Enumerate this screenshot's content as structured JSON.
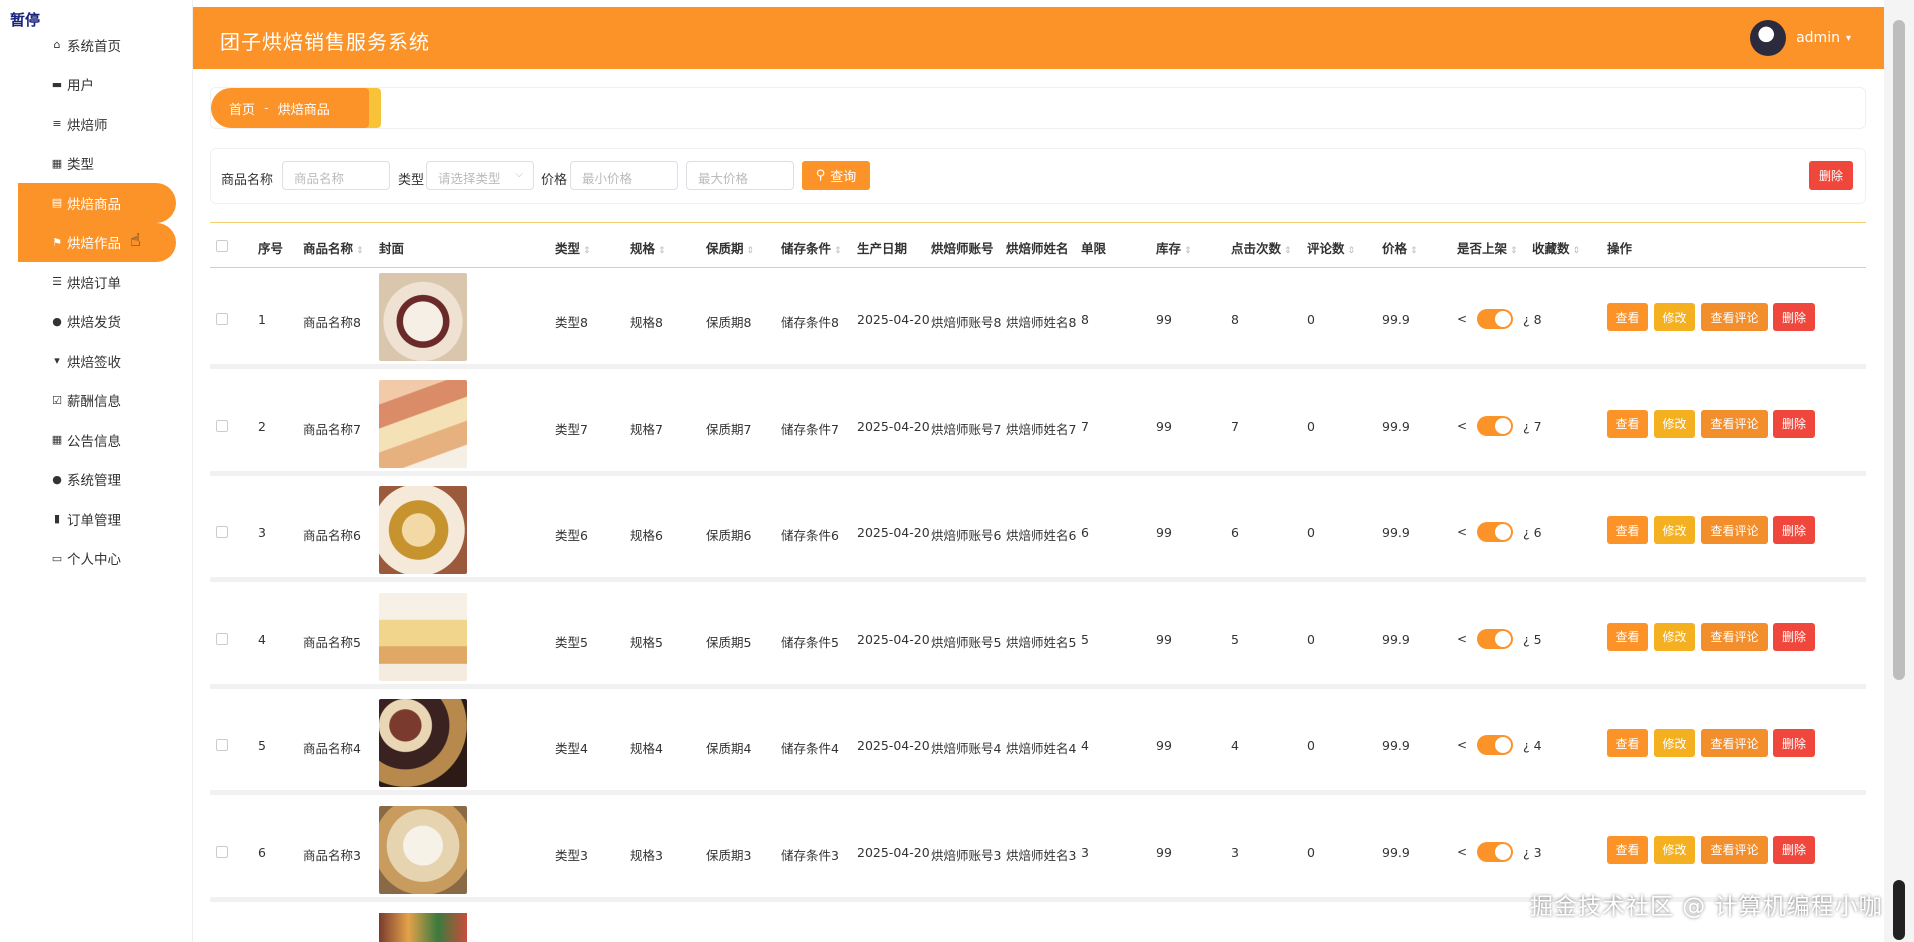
{
  "status_text": "暂停",
  "app_title": "团子烘焙销售服务系统",
  "user": {
    "name": "admin"
  },
  "sidebar": {
    "items": [
      {
        "label": "系统首页",
        "icon": "home-icon",
        "glyph": "⌂"
      },
      {
        "label": "用户",
        "icon": "monitor-icon",
        "glyph": "▬"
      },
      {
        "label": "烘焙师",
        "icon": "list-icon",
        "glyph": "≡"
      },
      {
        "label": "类型",
        "icon": "grid-icon",
        "glyph": "▦"
      },
      {
        "label": "烘焙商品",
        "icon": "clipboard-icon",
        "glyph": "▤",
        "active": true
      },
      {
        "label": "烘焙作品",
        "icon": "flag-icon",
        "glyph": "⚑",
        "active": true
      },
      {
        "label": "烘焙订单",
        "icon": "sliders-icon",
        "glyph": "☰"
      },
      {
        "label": "烘焙发货",
        "icon": "user-icon",
        "glyph": "●"
      },
      {
        "label": "烘焙签收",
        "icon": "cup-icon",
        "glyph": "▾"
      },
      {
        "label": "薪酬信息",
        "icon": "checklist-icon",
        "glyph": "☑"
      },
      {
        "label": "公告信息",
        "icon": "grid-icon",
        "glyph": "▦"
      },
      {
        "label": "系统管理",
        "icon": "user-icon",
        "glyph": "●"
      },
      {
        "label": "订单管理",
        "icon": "bar-chart-icon",
        "glyph": "▮"
      },
      {
        "label": "个人中心",
        "icon": "calendar-icon",
        "glyph": "▭"
      }
    ]
  },
  "breadcrumb": {
    "home": "首页",
    "sep": "-",
    "current": "烘焙商品"
  },
  "filter": {
    "name_label": "商品名称",
    "name_placeholder": "商品名称",
    "type_label": "类型",
    "type_placeholder": "请选择类型",
    "price_label": "价格",
    "min_placeholder": "最小价格",
    "max_placeholder": "最大价格",
    "search_label": "查询",
    "delete_label": "删除"
  },
  "table": {
    "headers": {
      "index": "序号",
      "name": "商品名称",
      "cover": "封面",
      "type": "类型",
      "spec": "规格",
      "shelf": "保质期",
      "storage": "储存条件",
      "date": "生产日期",
      "baker_acc": "烘焙师账号",
      "baker_name": "烘焙师姓名",
      "limit": "单限",
      "stock": "库存",
      "clicks": "点击次数",
      "comments": "评论数",
      "price": "价格",
      "on_sale": "是否上架",
      "favs": "收藏数",
      "ops": "操作"
    },
    "actions": {
      "view": "查看",
      "edit": "修改",
      "comments": "查看评论",
      "delete": "删除"
    },
    "rows": [
      {
        "index": "1",
        "name": "商品名称8",
        "type": "类型8",
        "spec": "规格8",
        "shelf": "保质期8",
        "storage": "储存条件8",
        "date": "2025-04-20",
        "baker_acc": "烘焙师账号8",
        "baker_name": "烘焙师姓名8",
        "limit": "8",
        "stock": "99",
        "clicks": "8",
        "comments": "0",
        "price": "99.9",
        "favs": "¿ 8",
        "cover": "cover-cake-berries"
      },
      {
        "index": "2",
        "name": "商品名称7",
        "type": "类型7",
        "spec": "规格7",
        "shelf": "保质期7",
        "storage": "储存条件7",
        "date": "2025-04-20",
        "baker_acc": "烘焙师账号7",
        "baker_name": "烘焙师姓名7",
        "limit": "7",
        "stock": "99",
        "clicks": "7",
        "comments": "0",
        "price": "99.9",
        "favs": "¿ 7",
        "cover": "cover-macarons"
      },
      {
        "index": "3",
        "name": "商品名称6",
        "type": "类型6",
        "spec": "规格6",
        "shelf": "保质期6",
        "storage": "储存条件6",
        "date": "2025-04-20",
        "baker_acc": "烘焙师账号6",
        "baker_name": "烘焙师姓名6",
        "limit": "6",
        "stock": "99",
        "clicks": "6",
        "comments": "0",
        "price": "99.9",
        "favs": "¿ 6",
        "cover": "cover-pastry"
      },
      {
        "index": "4",
        "name": "商品名称5",
        "type": "类型5",
        "spec": "规格5",
        "shelf": "保质期5",
        "storage": "储存条件5",
        "date": "2025-04-20",
        "baker_acc": "烘焙师账号5",
        "baker_name": "烘焙师姓名5",
        "limit": "5",
        "stock": "99",
        "clicks": "5",
        "comments": "0",
        "price": "99.9",
        "favs": "¿ 5",
        "cover": "cover-buns"
      },
      {
        "index": "5",
        "name": "商品名称4",
        "type": "类型4",
        "spec": "规格4",
        "shelf": "保质期4",
        "storage": "储存条件4",
        "date": "2025-04-20",
        "baker_acc": "烘焙师账号4",
        "baker_name": "烘焙师姓名4",
        "limit": "4",
        "stock": "99",
        "clicks": "4",
        "comments": "0",
        "price": "99.9",
        "favs": "¿ 4",
        "cover": "cover-cupcakes"
      },
      {
        "index": "6",
        "name": "商品名称3",
        "type": "类型3",
        "spec": "规格3",
        "shelf": "保质期3",
        "storage": "储存条件3",
        "date": "2025-04-20",
        "baker_acc": "烘焙师账号3",
        "baker_name": "烘焙师姓名3",
        "limit": "3",
        "stock": "99",
        "clicks": "3",
        "comments": "0",
        "price": "99.9",
        "favs": "¿ 3",
        "cover": "cover-cream-pie"
      }
    ]
  },
  "watermark": "掘金技术社区 @ 计算机编程小咖",
  "colors": {
    "accent": "#fc9328",
    "danger": "#f0473d",
    "edit": "#f5b021"
  }
}
